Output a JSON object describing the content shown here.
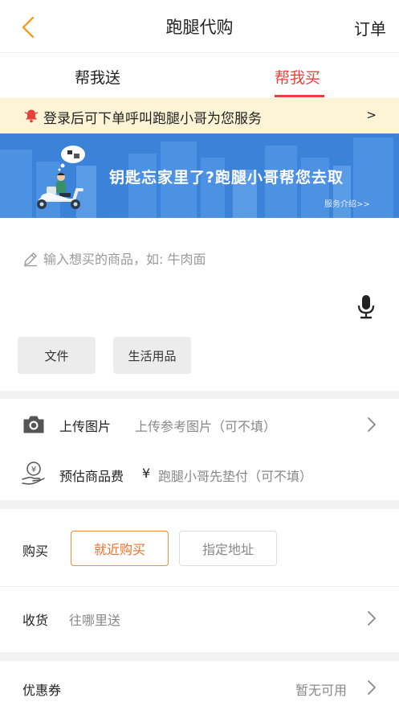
{
  "header": {
    "title": "跑腿代购",
    "orders_label": "订单"
  },
  "tabs": [
    {
      "label": "帮我送",
      "active": false
    },
    {
      "label": "帮我买",
      "active": true
    }
  ],
  "notice": {
    "text": "登录后可下单呼叫跑腿小哥为您服务",
    "arrow": ">"
  },
  "banner": {
    "title": "钥匙忘家里了?跑腿小哥帮您去取",
    "link_label": "服务介绍>>"
  },
  "item_input": {
    "placeholder": "输入想买的商品，如: 牛肉面",
    "value": ""
  },
  "quick_tags": [
    "文件",
    "生活用品"
  ],
  "upload": {
    "label": "上传图片",
    "hint": "上传参考图片（可不填）"
  },
  "estimate": {
    "label": "预估商品费",
    "currency": "¥",
    "hint": "跑腿小哥先垫付（可不填）"
  },
  "purchase": {
    "label": "购买",
    "options": [
      {
        "label": "就近购买",
        "selected": true
      },
      {
        "label": "指定地址",
        "selected": false
      }
    ]
  },
  "delivery": {
    "label": "收货",
    "hint": "往哪里送"
  },
  "coupon": {
    "label": "优惠券",
    "value": "暂无可用"
  },
  "colors": {
    "accent": "#e8413b",
    "orange": "#e8702a",
    "banner": "#3b82d9",
    "notice_bg": "#fdf4d6"
  }
}
